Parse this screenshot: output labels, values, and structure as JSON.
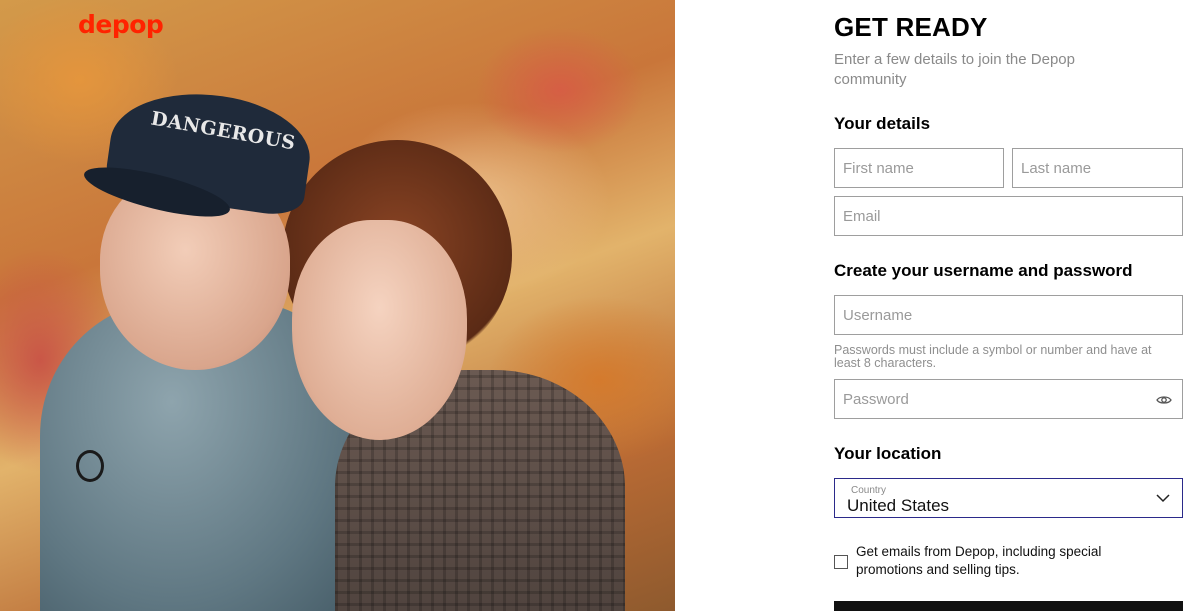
{
  "brand": {
    "logo_text": "depop",
    "accent_color": "#ff2300"
  },
  "hero": {
    "cap_text": "DANGEROUS"
  },
  "form": {
    "title": "GET READY",
    "subtitle": "Enter a few details to join the Depop community",
    "sections": {
      "details": "Your details",
      "credentials": "Create your username and password",
      "location": "Your location"
    },
    "fields": {
      "first_name": {
        "placeholder": "First name",
        "value": ""
      },
      "last_name": {
        "placeholder": "Last name",
        "value": ""
      },
      "email": {
        "placeholder": "Email",
        "value": ""
      },
      "username": {
        "placeholder": "Username",
        "value": ""
      },
      "password": {
        "placeholder": "Password",
        "value": ""
      }
    },
    "password_hint": "Passwords must include a symbol or number and have at least 8 characters.",
    "country": {
      "label": "Country",
      "value": "United States"
    },
    "marketing_opt_in": {
      "label": "Get emails from Depop, including special promotions and selling tips.",
      "checked": false
    },
    "icons": {
      "password_toggle": "eye-icon",
      "dropdown": "chevron-down-icon"
    }
  }
}
